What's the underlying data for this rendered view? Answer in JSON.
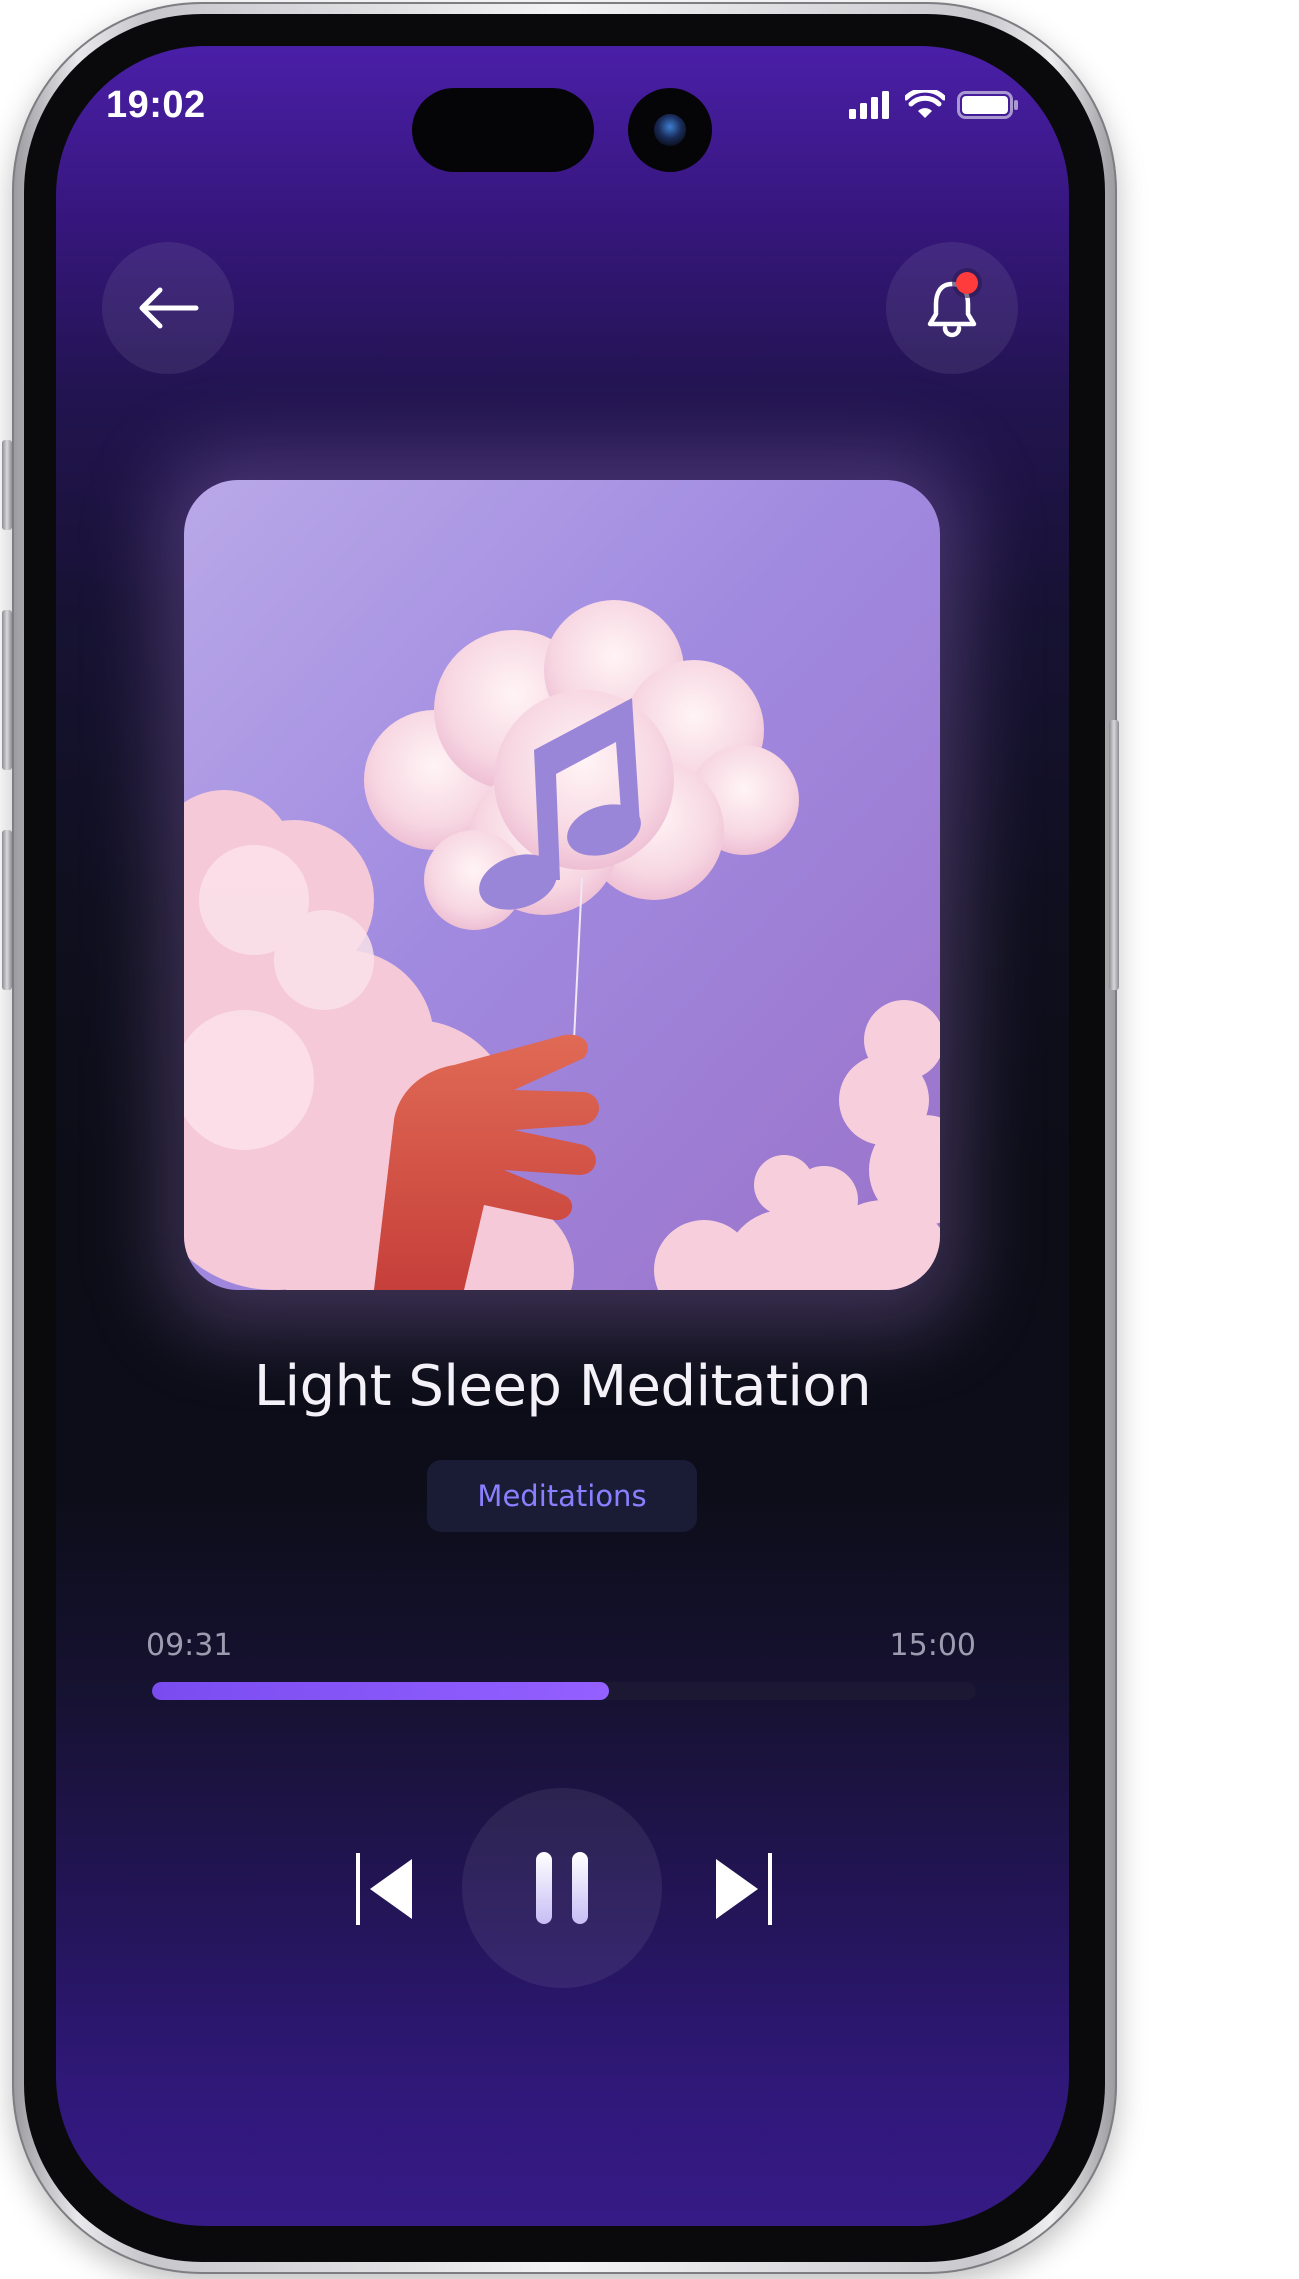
{
  "status_bar": {
    "time": "19:02"
  },
  "header": {
    "back_icon": "arrow-left-icon",
    "notification_icon": "bell-icon",
    "has_unread_notification": true
  },
  "player": {
    "artwork_icon": "music-note-cloud-artwork",
    "title": "Light Sleep Meditation",
    "category": "Meditations",
    "elapsed": "09:31",
    "duration": "15:00",
    "progress_fraction": 0.555,
    "state": "playing"
  },
  "controls": {
    "previous_icon": "skip-previous-icon",
    "pause_icon": "pause-icon",
    "next_icon": "skip-next-icon"
  },
  "colors": {
    "accent": "#7a4cf0",
    "chip_text": "#8a80ff",
    "notification_dot": "#ff3b3b",
    "screen_top": "#4a1fa8",
    "screen_mid": "#0c0d17"
  }
}
